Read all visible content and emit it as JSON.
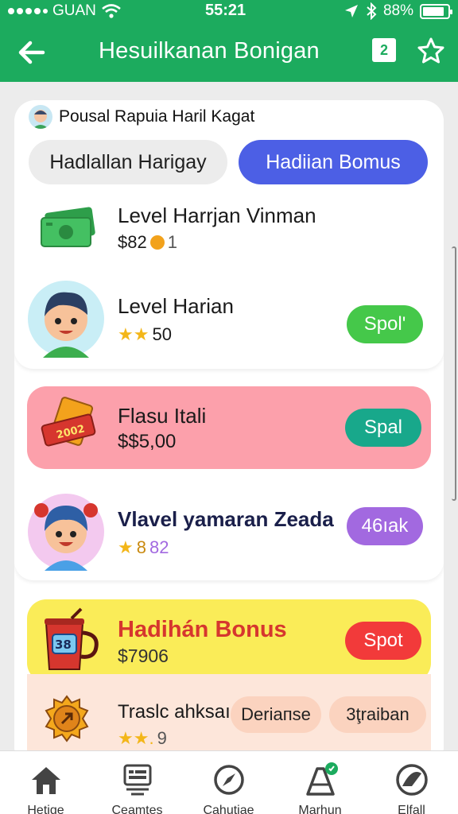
{
  "status": {
    "carrier": "GUAN",
    "time": "55:21",
    "battery": "88%",
    "battery_level": 0.88
  },
  "appbar": {
    "title": "Hesuilkanan Bonigan",
    "badge": "2"
  },
  "card": {
    "header_title": "Pousal Rapuia Haril Kagat",
    "tabs": [
      {
        "label": "Hadlallan Harigay"
      },
      {
        "label": "Hadiian Bomus"
      }
    ],
    "rows": [
      {
        "title": "Level Harrjan Vinman",
        "sub_text": "$82",
        "sub_extra": "1"
      },
      {
        "title": "Level Harian",
        "sub_text": "50",
        "button": "Spol'"
      },
      {
        "title": "Flasu Itali",
        "sub_text": "$$5,00",
        "button": "Spal",
        "icon_label": "2002"
      },
      {
        "title": "Vlavel yamaran Zeada",
        "sub_num1": "8",
        "sub_num2": "82",
        "button": "46ıak"
      },
      {
        "title": "Hadihán Bonus",
        "sub_text": "$7906",
        "button": "Spot",
        "icon_label": "38"
      },
      {
        "title": "Traslc ahksaı",
        "sub_num": "9",
        "button_1": "Deriaпse",
        "button_2": "3ţraiban"
      }
    ]
  },
  "bottom_nav": [
    {
      "label": "Hetige",
      "icon": "home-icon"
    },
    {
      "label": "Ceamtes",
      "icon": "cashier-icon"
    },
    {
      "label": "Cahutiae",
      "icon": "compass-icon"
    },
    {
      "label": "Marhun",
      "icon": "bag-icon"
    },
    {
      "label": "Elfall",
      "icon": "globe-icon"
    }
  ],
  "colors": {
    "brand_green": "#1cab5e",
    "tab_blue": "#4c5fe5",
    "pink_row": "#fca0ab",
    "yellow_row": "#faec58",
    "btn_green": "#45c84a",
    "btn_teal": "#18a88b",
    "btn_purple": "#a269e0",
    "btn_red": "#f23a3a",
    "title_red": "#d6362e"
  }
}
